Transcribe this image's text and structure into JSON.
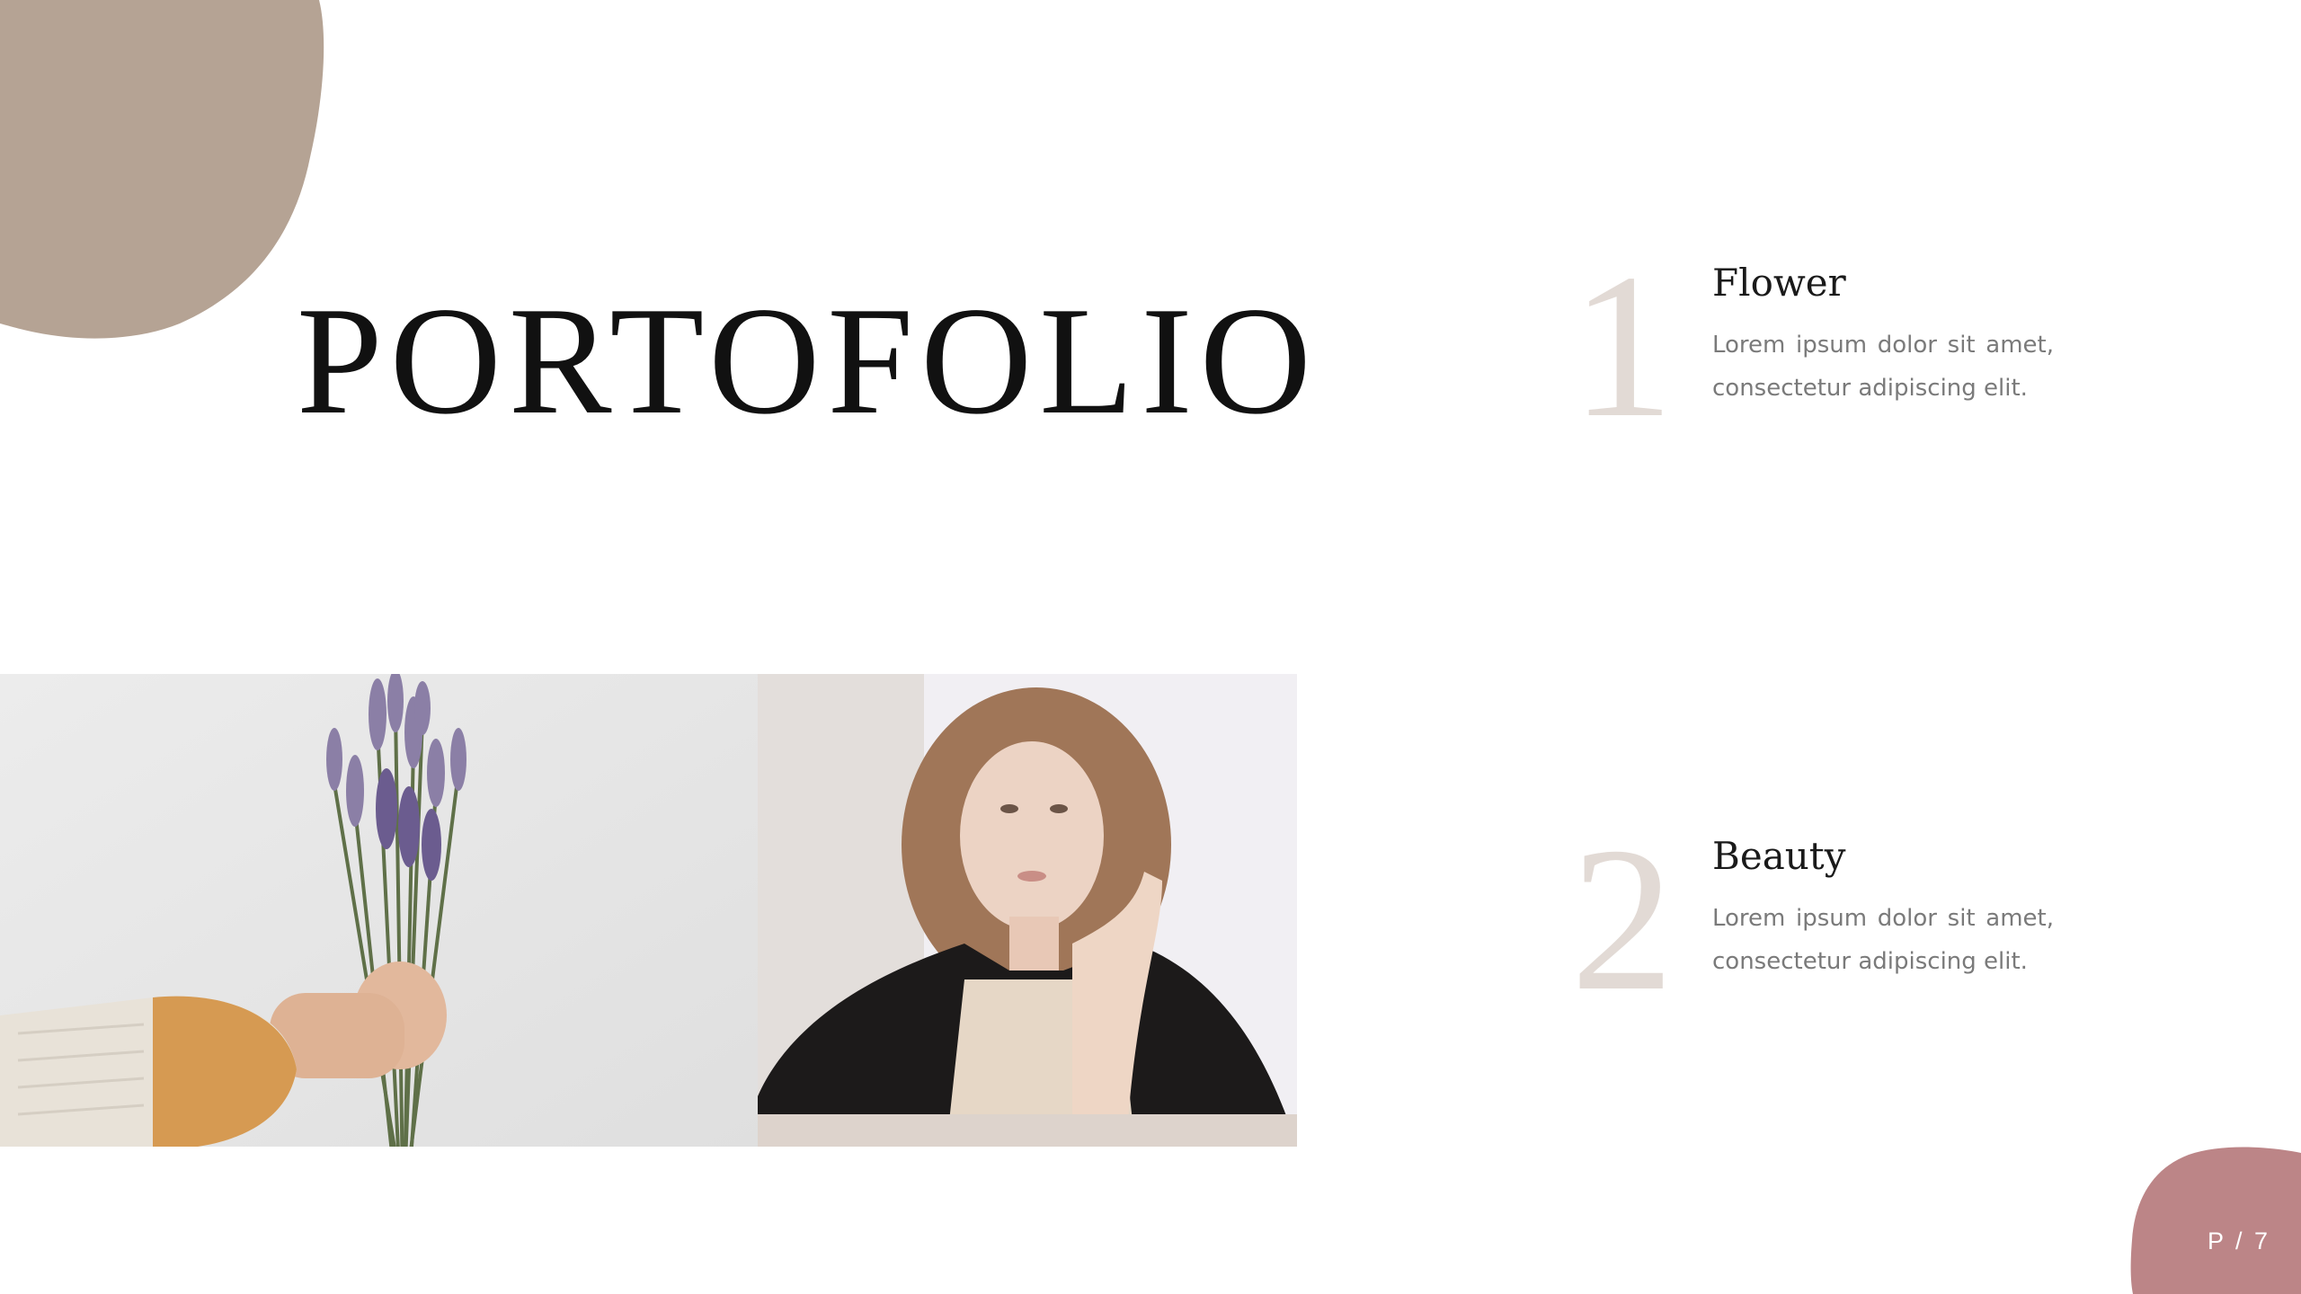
{
  "slide": {
    "title": "PORTOFOLIO",
    "page_number": "P / 7",
    "colors": {
      "accent_top": "#b5a394",
      "accent_bottom": "#bc8587",
      "number_color": "#e2dad5"
    }
  },
  "photos": [
    {
      "icon": "lavender-bouquet-photo"
    },
    {
      "icon": "woman-portrait-photo"
    }
  ],
  "items": [
    {
      "number": "1",
      "title": "Flower",
      "description": "Lorem ipsum dolor sit amet, consectetur adipiscing elit."
    },
    {
      "number": "2",
      "title": "Beauty",
      "description": "Lorem ipsum dolor sit amet, consectetur adipiscing elit."
    }
  ]
}
